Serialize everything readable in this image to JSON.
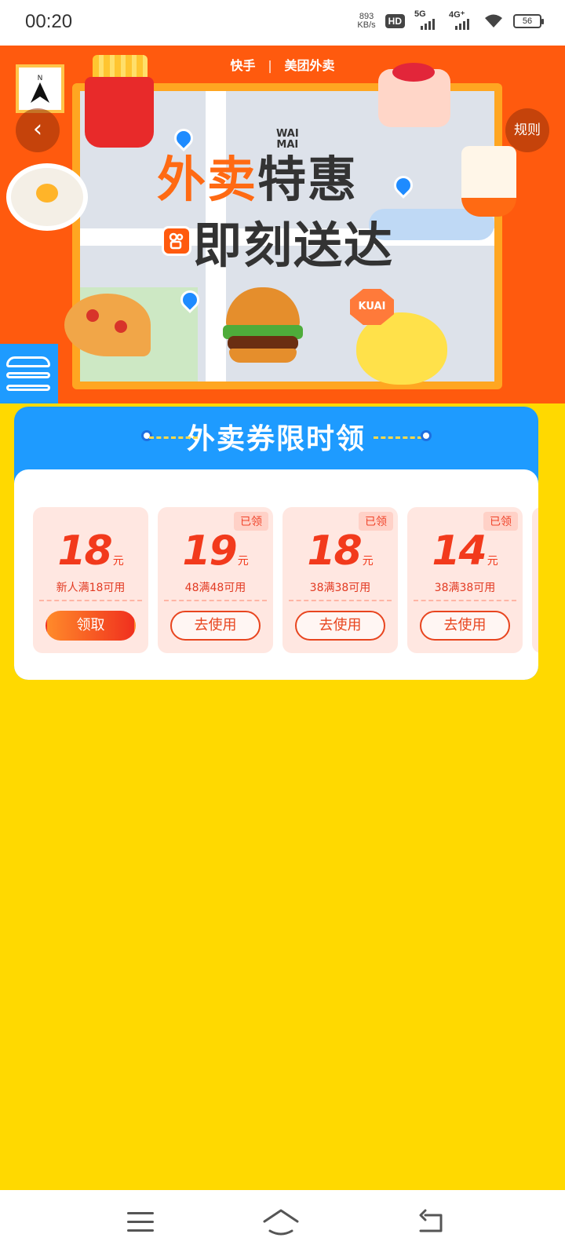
{
  "status_bar": {
    "time": "00:20",
    "net_speed_value": "893",
    "net_speed_unit": "KB/s",
    "hd_label": "HD",
    "sim1_label": "5G",
    "sim2_label": "4G⁺",
    "battery": "56"
  },
  "banner": {
    "brand_kuaishou": "快手",
    "brand_meituan": "美团外卖",
    "rules_label": "规则",
    "headline_part1": "外卖",
    "headline_part2": "特惠",
    "headline_line2": "即刻送达",
    "waimai_tag_1": "WAI",
    "waimai_tag_2": "MAI",
    "kuai_sign": "KUAI",
    "compass_label": "N"
  },
  "coupon_section": {
    "title": "外卖券限时领",
    "coupons": [
      {
        "amount": "18",
        "unit": "元",
        "condition": "新人满18可用",
        "button": "领取",
        "claimed_tag": ""
      },
      {
        "amount": "19",
        "unit": "元",
        "condition": "48满48可用",
        "button": "去使用",
        "claimed_tag": "已领"
      },
      {
        "amount": "18",
        "unit": "元",
        "condition": "38满38可用",
        "button": "去使用",
        "claimed_tag": "已领"
      },
      {
        "amount": "14",
        "unit": "元",
        "condition": "38满38可用",
        "button": "去使用",
        "claimed_tag": "已领"
      }
    ]
  },
  "colors": {
    "page_background": "#FFD900",
    "banner_orange": "#FF5A0E",
    "coupon_header_blue": "#1E9BFF",
    "coupon_red": "#F23A1C"
  }
}
